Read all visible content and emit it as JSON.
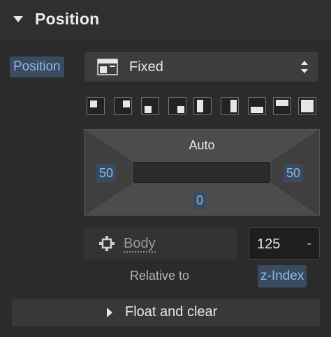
{
  "header": {
    "title": "Position"
  },
  "position": {
    "label": "Position",
    "select_value": "Fixed",
    "select_icon": "fixed-position-icon"
  },
  "presets": [
    {
      "name": "preset-top-left"
    },
    {
      "name": "preset-top-right"
    },
    {
      "name": "preset-bottom-left"
    },
    {
      "name": "preset-bottom-right"
    },
    {
      "name": "preset-left"
    },
    {
      "name": "preset-right"
    },
    {
      "name": "preset-bottom"
    },
    {
      "name": "preset-top"
    },
    {
      "name": "preset-full"
    }
  ],
  "box": {
    "top": "Auto",
    "left": "50",
    "right": "50",
    "bottom": "0"
  },
  "relative": {
    "value": "Body",
    "icon": "body-element-icon",
    "label": "Relative to"
  },
  "zindex": {
    "value": "125",
    "unit": "-",
    "label": "z-Index"
  },
  "float": {
    "label": "Float and clear"
  }
}
